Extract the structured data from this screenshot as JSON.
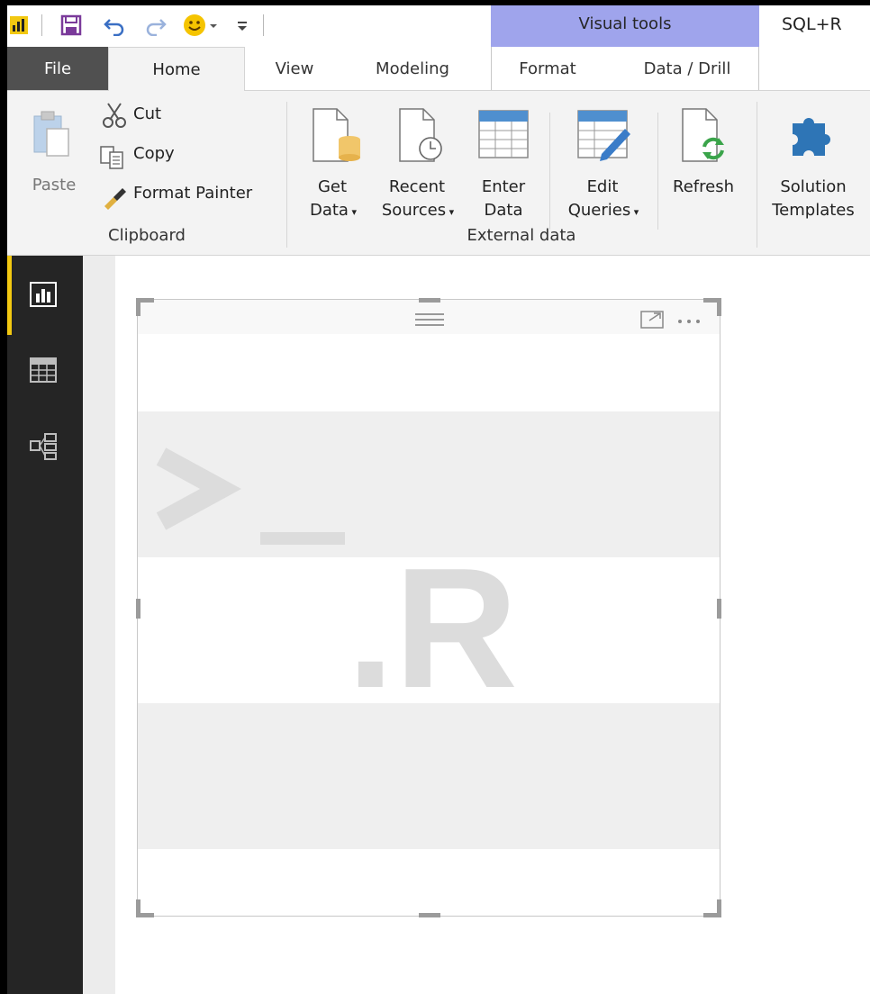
{
  "titlebar": {
    "contextual_group": "Visual tools",
    "document_title": "SQL+R"
  },
  "tabs": {
    "file": "File",
    "home": "Home",
    "view": "View",
    "modeling": "Modeling",
    "format": "Format",
    "data_drill": "Data / Drill"
  },
  "ribbon": {
    "clipboard": {
      "paste": "Paste",
      "cut": "Cut",
      "copy": "Copy",
      "format_painter": "Format Painter",
      "group_label": "Clipboard"
    },
    "external_data": {
      "get_data": [
        "Get",
        "Data"
      ],
      "recent_sources": [
        "Recent",
        "Sources"
      ],
      "enter_data": [
        "Enter",
        "Data"
      ],
      "edit_queries": [
        "Edit",
        "Queries"
      ],
      "refresh": "Refresh",
      "group_label": "External data"
    },
    "solution_templates": [
      "Solution",
      "Templates"
    ]
  },
  "visual": {
    "placeholder_glyph": ".R",
    "prompt_glyph": ">_"
  },
  "colors": {
    "accent_yellow": "#f2c811",
    "contextual_band": "#9fa4ec",
    "nav_background": "#252525",
    "puzzle_blue": "#2e75b6"
  },
  "icons": {
    "app": "powerbi-logo-icon",
    "save": "save-icon",
    "undo": "undo-icon",
    "redo": "redo-icon",
    "smiley": "smiley-icon",
    "customize": "customize-qat-icon",
    "report_view": "report-view-icon",
    "data_view": "data-view-icon",
    "relationships_view": "relationships-view-icon",
    "focus_mode": "focus-mode-icon",
    "more_options": "more-options-icon"
  }
}
